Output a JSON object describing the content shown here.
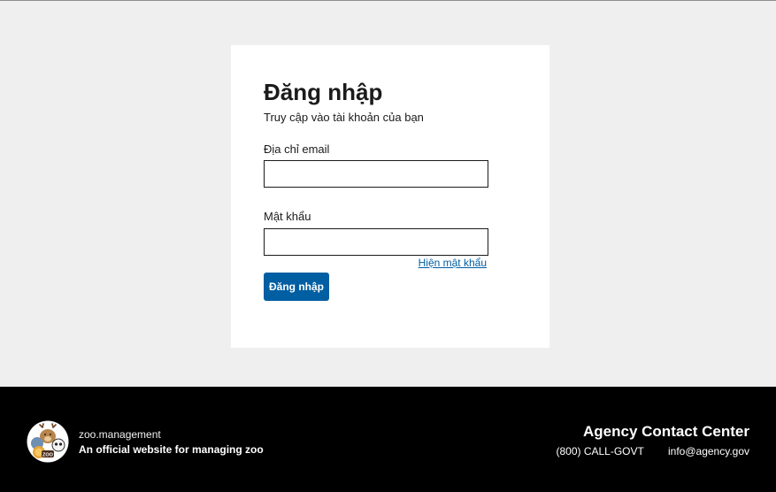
{
  "login": {
    "title": "Đăng nhập",
    "subtitle": "Truy cập vào tài khoản của bạn",
    "email_label": "Địa chỉ email",
    "email_value": "",
    "password_label": "Mật khẩu",
    "password_value": "",
    "show_password_label": "Hiện mật khẩu",
    "submit_label": "Đăng nhập"
  },
  "footer": {
    "logo_text": "ZOO",
    "domain": "zoo.management",
    "description": "An official website for managing zoo",
    "contact_title": "Agency Contact Center",
    "phone": "(800) CALL-GOVT",
    "email": "info@agency.gov"
  },
  "colors": {
    "primary": "#005ea2",
    "page_background": "#efefef",
    "footer_background": "#000000"
  }
}
